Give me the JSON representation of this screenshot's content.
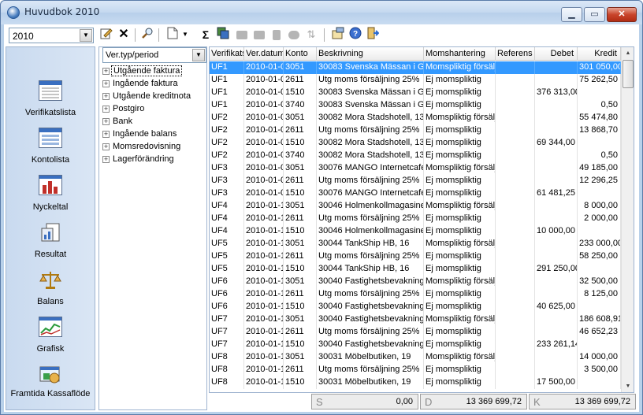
{
  "window": {
    "title": "Huvudbok 2010",
    "minimize": "▁",
    "maximize": "▭",
    "close": "✕"
  },
  "year_select": {
    "value": "2010"
  },
  "toolbar": {
    "buttons": [
      "edit-icon",
      "delete-icon",
      "search-icon",
      "document-icon",
      "dropdown-arrow-icon",
      "sum-icon",
      "report-icon",
      "disabled-icon",
      "disabled-icon",
      "disabled-icon",
      "disabled-icon",
      "disabled-icon",
      "settings-icon",
      "help-icon",
      "exit-icon"
    ],
    "sum_glyph": "Σ"
  },
  "sidebar": {
    "items": [
      {
        "label": "Verifikatslista",
        "icon": "verifikatslista-icon"
      },
      {
        "label": "Kontolista",
        "icon": "kontolista-icon"
      },
      {
        "label": "Nyckeltal",
        "icon": "nyckeltal-icon"
      },
      {
        "label": "Resultat",
        "icon": "resultat-icon"
      },
      {
        "label": "Balans",
        "icon": "balans-icon"
      },
      {
        "label": "Grafisk",
        "icon": "grafisk-icon"
      },
      {
        "label": "Framtida Kassaflöde",
        "icon": "kassaflode-icon"
      }
    ]
  },
  "tree": {
    "select_value": "Ver.typ/period",
    "items": [
      "Utgående faktura",
      "Ingående faktura",
      "Utgående kreditnota",
      "Postgiro",
      "Bank",
      "Ingående balans",
      "Momsredovisning",
      "Lagerförändring"
    ]
  },
  "grid": {
    "columns": [
      "Verifikats",
      "Ver.datum",
      "Konto",
      "Beskrivning",
      "Momshantering",
      "Referens",
      "Debet",
      "Kredit"
    ],
    "rows": [
      [
        "UF1",
        "2010-01-0",
        "3051",
        "30083 Svenska Mässan i G",
        "Momspliktig försälj",
        "",
        "",
        "301 050,00"
      ],
      [
        "UF1",
        "2010-01-0",
        "2611",
        "Utg moms försäljning 25%",
        "Ej momspliktig",
        "",
        "",
        "75 262,50"
      ],
      [
        "UF1",
        "2010-01-0",
        "1510",
        "30083 Svenska Mässan i G",
        "Ej momspliktig",
        "",
        "376 313,00",
        ""
      ],
      [
        "UF1",
        "2010-01-0",
        "3740",
        "30083 Svenska Mässan i G",
        "Ej momspliktig",
        "",
        "",
        "0,50"
      ],
      [
        "UF2",
        "2010-01-0",
        "3051",
        "30082 Mora Stadshotell, 13",
        "Momspliktig försälj",
        "",
        "",
        "55 474,80"
      ],
      [
        "UF2",
        "2010-01-0",
        "2611",
        "Utg moms försäljning 25%",
        "Ej momspliktig",
        "",
        "",
        "13 868,70"
      ],
      [
        "UF2",
        "2010-01-0",
        "1510",
        "30082 Mora Stadshotell, 13",
        "Ej momspliktig",
        "",
        "69 344,00",
        ""
      ],
      [
        "UF2",
        "2010-01-0",
        "3740",
        "30082 Mora Stadshotell, 13",
        "Ej momspliktig",
        "",
        "",
        "0,50"
      ],
      [
        "UF3",
        "2010-01-0",
        "3051",
        "30076 MANGO Internetcafe",
        "Momspliktig försälj",
        "",
        "",
        "49 185,00"
      ],
      [
        "UF3",
        "2010-01-0",
        "2611",
        "Utg moms försäljning 25%",
        "Ej momspliktig",
        "",
        "",
        "12 296,25"
      ],
      [
        "UF3",
        "2010-01-0",
        "1510",
        "30076 MANGO Internetcafe",
        "Ej momspliktig",
        "",
        "61 481,25",
        ""
      ],
      [
        "UF4",
        "2010-01-1",
        "3051",
        "30046 Holmenkollmagasinet",
        "Momspliktig försälj",
        "",
        "",
        "8 000,00"
      ],
      [
        "UF4",
        "2010-01-1",
        "2611",
        "Utg moms försäljning 25%",
        "Ej momspliktig",
        "",
        "",
        "2 000,00"
      ],
      [
        "UF4",
        "2010-01-1",
        "1510",
        "30046 Holmenkollmagasinet",
        "Ej momspliktig",
        "",
        "10 000,00",
        ""
      ],
      [
        "UF5",
        "2010-01-1",
        "3051",
        "30044 TankShip HB, 16",
        "Momspliktig försälj",
        "",
        "",
        "233 000,00"
      ],
      [
        "UF5",
        "2010-01-1",
        "2611",
        "Utg moms försäljning 25%",
        "Ej momspliktig",
        "",
        "",
        "58 250,00"
      ],
      [
        "UF5",
        "2010-01-1",
        "1510",
        "30044 TankShip HB, 16",
        "Ej momspliktig",
        "",
        "291 250,00",
        ""
      ],
      [
        "UF6",
        "2010-01-1",
        "3051",
        "30040 Fastighetsbevakning",
        "Momspliktig försälj",
        "",
        "",
        "32 500,00"
      ],
      [
        "UF6",
        "2010-01-1",
        "2611",
        "Utg moms försäljning 25%",
        "Ej momspliktig",
        "",
        "",
        "8 125,00"
      ],
      [
        "UF6",
        "2010-01-1",
        "1510",
        "30040 Fastighetsbevakning",
        "Ej momspliktig",
        "",
        "40 625,00",
        ""
      ],
      [
        "UF7",
        "2010-01-1",
        "3051",
        "30040 Fastighetsbevakning",
        "Momspliktig försälj",
        "",
        "",
        "186 608,91"
      ],
      [
        "UF7",
        "2010-01-1",
        "2611",
        "Utg moms försäljning 25%",
        "Ej momspliktig",
        "",
        "",
        "46 652,23"
      ],
      [
        "UF7",
        "2010-01-1",
        "1510",
        "30040 Fastighetsbevakning",
        "Ej momspliktig",
        "",
        "233 261,14",
        ""
      ],
      [
        "UF8",
        "2010-01-1",
        "3051",
        "30031 Möbelbutiken, 19",
        "Momspliktig försälj",
        "",
        "",
        "14 000,00"
      ],
      [
        "UF8",
        "2010-01-1",
        "2611",
        "Utg moms försäljning 25%",
        "Ej momspliktig",
        "",
        "",
        "3 500,00"
      ],
      [
        "UF8",
        "2010-01-1",
        "1510",
        "30031 Möbelbutiken, 19",
        "Ej momspliktig",
        "",
        "17 500,00",
        ""
      ]
    ]
  },
  "status": {
    "s_label": "S",
    "s_value": "0,00",
    "d_label": "D",
    "d_value": "13 369 699,72",
    "k_label": "K",
    "k_value": "13 369 699,72"
  }
}
